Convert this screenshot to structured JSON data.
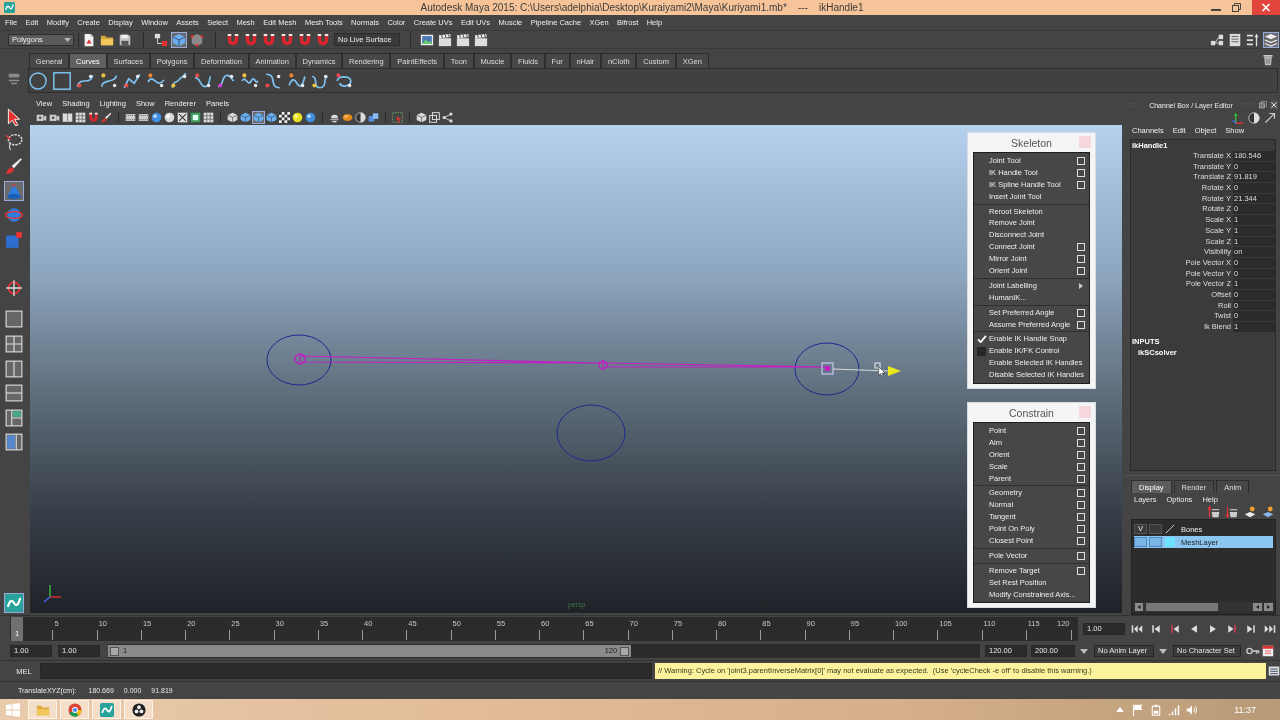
{
  "window": {
    "title": "Autodesk Maya 2015: C:\\Users\\adelphia\\Desktop\\Kuraiyami2\\Maya\\Kuriyami1.mb*    ---    ikHandle1"
  },
  "menu_bar": [
    "File",
    "Edit",
    "Modify",
    "Create",
    "Display",
    "Window",
    "Assets",
    "Select",
    "Mesh",
    "Edit Mesh",
    "Mesh Tools",
    "Normals",
    "Color",
    "Create UVs",
    "Edit UVs",
    "Muscle",
    "Pipeline Cache",
    "XGen",
    "Bifrost",
    "Help"
  ],
  "status_line": {
    "menu_set": "Polygons",
    "live_surface": "No Live Surface"
  },
  "shelf": {
    "tabs": [
      {
        "label": "General",
        "selected": false
      },
      {
        "label": "Curves",
        "selected": true
      },
      {
        "label": "Surfaces",
        "selected": false
      },
      {
        "label": "Polygons",
        "selected": false
      },
      {
        "label": "Deformation",
        "selected": false
      },
      {
        "label": "Animation",
        "selected": false
      },
      {
        "label": "Dynamics",
        "selected": false
      },
      {
        "label": "Rendering",
        "selected": false
      },
      {
        "label": "PaintEffects",
        "selected": false
      },
      {
        "label": "Toon",
        "selected": false
      },
      {
        "label": "Muscle",
        "selected": false
      },
      {
        "label": "Fluids",
        "selected": false
      },
      {
        "label": "Fur",
        "selected": false
      },
      {
        "label": "nHair",
        "selected": false
      },
      {
        "label": "nCloth",
        "selected": false
      },
      {
        "label": "Custom",
        "selected": false
      },
      {
        "label": "XGen",
        "selected": false
      }
    ]
  },
  "viewport": {
    "menu": [
      "View",
      "Shading",
      "Lighting",
      "Show",
      "Renderer",
      "Panels"
    ],
    "camera": "persp"
  },
  "skeleton_menu": {
    "title": "Skeleton",
    "sections": [
      [
        {
          "label": "Joint Tool",
          "kind": "option"
        },
        {
          "label": "IK Handle Tool",
          "kind": "option"
        },
        {
          "label": "IK Spline Handle Tool",
          "kind": "option"
        },
        {
          "label": "Insert Joint Tool",
          "kind": "plain"
        }
      ],
      [
        {
          "label": "Reroot Skeleton",
          "kind": "plain"
        },
        {
          "label": "Remove Joint",
          "kind": "plain"
        },
        {
          "label": "Disconnect Joint",
          "kind": "plain"
        },
        {
          "label": "Connect Joint",
          "kind": "option"
        },
        {
          "label": "Mirror Joint",
          "kind": "option"
        },
        {
          "label": "Orient Joint",
          "kind": "option"
        }
      ],
      [
        {
          "label": "Joint Labelling",
          "kind": "submenu"
        },
        {
          "label": "HumanIK...",
          "kind": "plain"
        }
      ],
      [
        {
          "label": "Set Preferred Angle",
          "kind": "option"
        },
        {
          "label": "Assume Preferred Angle",
          "kind": "option"
        }
      ],
      [
        {
          "label": "Enable IK Handle Snap",
          "kind": "check",
          "checked": true
        },
        {
          "label": "Enable IK/FK Control",
          "kind": "check",
          "checked": false
        },
        {
          "label": "Enable Selected IK Handles",
          "kind": "plain"
        },
        {
          "label": "Disable Selected IK Handles",
          "kind": "plain"
        }
      ]
    ]
  },
  "constrain_menu": {
    "title": "Constrain",
    "sections": [
      [
        {
          "label": "Point",
          "kind": "option"
        },
        {
          "label": "Aim",
          "kind": "option"
        },
        {
          "label": "Orient",
          "kind": "option"
        },
        {
          "label": "Scale",
          "kind": "option"
        },
        {
          "label": "Parent",
          "kind": "option"
        }
      ],
      [
        {
          "label": "Geometry",
          "kind": "option"
        },
        {
          "label": "Normal",
          "kind": "option"
        },
        {
          "label": "Tangent",
          "kind": "option"
        },
        {
          "label": "Point On Poly",
          "kind": "option"
        },
        {
          "label": "Closest Point",
          "kind": "option"
        }
      ],
      [
        {
          "label": "Pole Vector",
          "kind": "option"
        }
      ],
      [
        {
          "label": "Remove Target",
          "kind": "option"
        },
        {
          "label": "Set Rest Position",
          "kind": "plain"
        },
        {
          "label": "Modify Constrained Axis...",
          "kind": "plain"
        }
      ]
    ]
  },
  "channel_box": {
    "title": "Channel Box / Layer Editor",
    "menu": [
      "Channels",
      "Edit",
      "Object",
      "Show"
    ],
    "node": "ikHandle1",
    "attributes": [
      {
        "name": "Translate X",
        "value": "180.546"
      },
      {
        "name": "Translate Y",
        "value": "0"
      },
      {
        "name": "Translate Z",
        "value": "91.819"
      },
      {
        "name": "Rotate X",
        "value": "0"
      },
      {
        "name": "Rotate Y",
        "value": "21.344"
      },
      {
        "name": "Rotate Z",
        "value": "0"
      },
      {
        "name": "Scale X",
        "value": "1"
      },
      {
        "name": "Scale Y",
        "value": "1"
      },
      {
        "name": "Scale Z",
        "value": "1"
      },
      {
        "name": "Visibility",
        "value": "on"
      },
      {
        "name": "Pole Vector X",
        "value": "0"
      },
      {
        "name": "Pole Vector Y",
        "value": "0"
      },
      {
        "name": "Pole Vector Z",
        "value": "1"
      },
      {
        "name": "Offset",
        "value": "0"
      },
      {
        "name": "Roll",
        "value": "0"
      },
      {
        "name": "Twist",
        "value": "0"
      },
      {
        "name": "Ik Blend",
        "value": "1"
      }
    ],
    "inputs_title": "INPUTS",
    "inputs": [
      "ikSCsolver"
    ]
  },
  "layer_editor": {
    "tabs": [
      {
        "label": "Display",
        "selected": true
      },
      {
        "label": "Render",
        "selected": false
      },
      {
        "label": "Anim",
        "selected": false
      }
    ],
    "menu": [
      "Layers",
      "Options",
      "Help"
    ],
    "layers": [
      {
        "visibility": "V",
        "name": "Bones",
        "selected": false
      },
      {
        "name": "MeshLayer",
        "selected": true
      }
    ]
  },
  "time_slider": {
    "level": 0,
    "current_frame": "1",
    "ticks": [
      "5",
      "10",
      "15",
      "20",
      "25",
      "30",
      "35",
      "40",
      "45",
      "50",
      "55",
      "60",
      "65",
      "70",
      "75",
      "80",
      "85",
      "90",
      "95",
      "100",
      "105",
      "110",
      "115",
      "120"
    ],
    "current_time": "1.00"
  },
  "range_slider": {
    "start_time": "1.00",
    "range_start": "1.00",
    "level": 0.6,
    "slider_start": "1",
    "slider_end": "120",
    "range_end": "120.00",
    "end_time": "200.00",
    "anim_layer": "No Anim Layer",
    "character_set": "No Character Set"
  },
  "command_line": {
    "language": "MEL",
    "warning": "// Warning: Cycle on 'joint3.parentInverseMatrix[0]' may not evaluate as expected.  (Use 'cycleCheck -e off' to disable this warning.)"
  },
  "help_line": {
    "label": "TranslateXYZ(cm):",
    "values": [
      "180.669",
      "0.000",
      "91.819"
    ]
  },
  "taskbar": {
    "clock": "11:37"
  }
}
